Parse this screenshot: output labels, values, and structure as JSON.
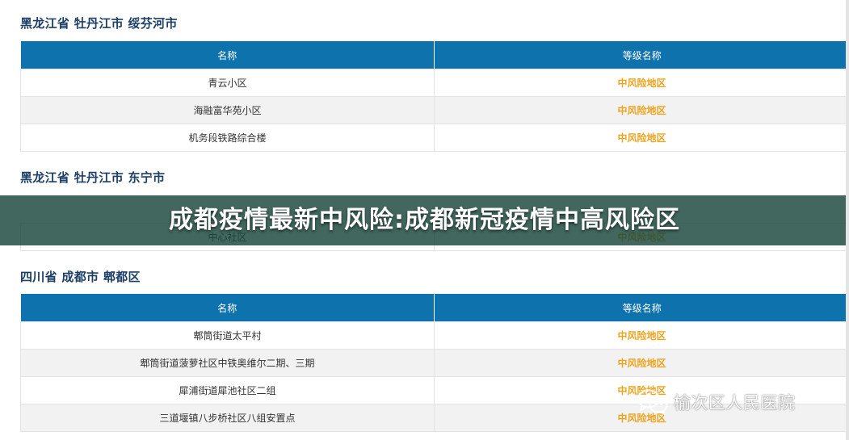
{
  "sections": [
    {
      "title": "黑龙江省 牡丹江市 绥芬河市",
      "header": {
        "name": "名称",
        "level": "等级名称"
      },
      "rows": [
        {
          "name": "青云小区",
          "level": "中风险地区"
        },
        {
          "name": "海融富华苑小区",
          "level": "中风险地区"
        },
        {
          "name": "机务段铁路综合楼",
          "level": "中风险地区"
        }
      ]
    },
    {
      "title": "黑龙江省 牡丹江市 东宁市",
      "rows": [
        {
          "name": "中心社区",
          "level": "中风险地区"
        }
      ]
    },
    {
      "title": "四川省 成都市 郫都区",
      "header": {
        "name": "名称",
        "level": "等级名称"
      },
      "rows": [
        {
          "name": "郫筒街道太平村",
          "level": "中风险地区"
        },
        {
          "name": "郫筒街道菠萝社区中铁奥维尔二期、三期",
          "level": "中风险地区"
        },
        {
          "name": "犀浦街道犀池社区二组",
          "level": "中风险地区"
        },
        {
          "name": "三道堰镇八步桥社区八组安置点",
          "level": "中风险地区"
        }
      ]
    }
  ],
  "banner": {
    "text": "成都疫情最新中风险:成都新冠疫情中高风险区"
  },
  "watermark": {
    "icon": "wechat-icon",
    "text": "榆次区人民医院"
  },
  "colors": {
    "header_bg": "#0e72ad",
    "title_text": "#1d3f66",
    "level_text": "#f0a21c",
    "alt_row_bg": "#f2f2f2",
    "banner_bg": "#17463a"
  }
}
